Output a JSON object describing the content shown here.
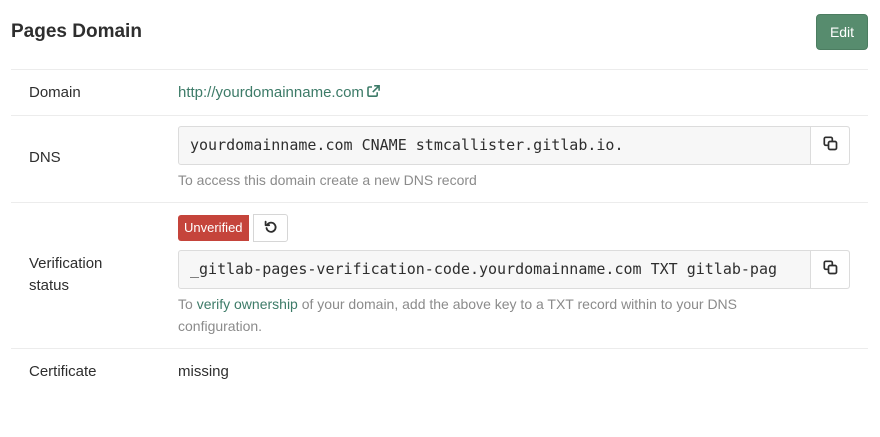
{
  "header": {
    "title": "Pages Domain",
    "edit_label": "Edit"
  },
  "rows": {
    "domain": {
      "label": "Domain",
      "url": "http://yourdomainname.com",
      "icon": "external-link-icon"
    },
    "dns": {
      "label": "DNS",
      "record": "yourdomainname.com CNAME stmcallister.gitlab.io.",
      "help": "To access this domain create a new DNS record",
      "copy_icon": "copy-icon"
    },
    "verification": {
      "label_line1": "Verification",
      "label_line2": "status",
      "badge": "Unverified",
      "retry_icon": "retry-icon",
      "record": "_gitlab-pages-verification-code.yourdomainname.com TXT gitlab-pag",
      "help_prefix": "To ",
      "help_link": "verify ownership",
      "help_line1_rest": " of your domain, add the above key to a TXT record within to your DNS",
      "help_line2": "configuration.",
      "copy_icon": "copy-icon"
    },
    "certificate": {
      "label": "Certificate",
      "value": "missing"
    }
  },
  "colors": {
    "primary_button": "#578c6e",
    "link": "#3d7b68",
    "badge_danger": "#c5443b",
    "muted_text": "#8b8b8b"
  }
}
